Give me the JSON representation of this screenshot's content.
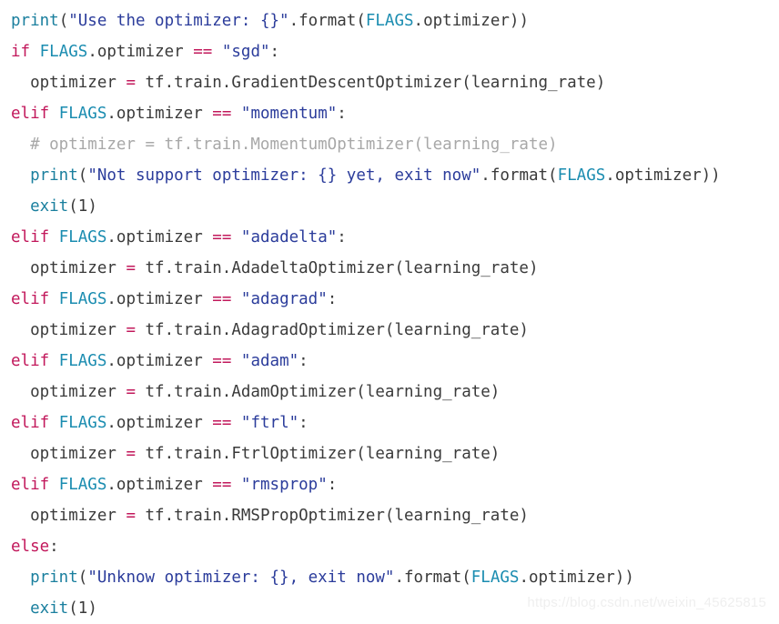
{
  "page": {
    "background": "#ffffff",
    "language": "python",
    "line_count": 20
  },
  "theme": {
    "keyword": "#c2185b",
    "operator": "#c2185b",
    "builtin": "#1a7f9e",
    "name": "#1a8cb0",
    "string": "#2b3c9b",
    "plain": "#3a3a3a",
    "comment": "#a8a8a8",
    "watermark": "#efefef"
  },
  "watermark": {
    "text": "https://blog.csdn.net/weixin_45625815"
  },
  "code": {
    "lines": [
      {
        "index": 1,
        "text": "print(\"Use the optimizer: {}\".format(FLAGS.optimizer))",
        "tokens": [
          {
            "t": "print",
            "c": "builtin"
          },
          {
            "t": "(",
            "c": "punct"
          },
          {
            "t": "\"Use the optimizer: {}\"",
            "c": "str"
          },
          {
            "t": ".format(",
            "c": "plain"
          },
          {
            "t": "FLAGS",
            "c": "name"
          },
          {
            "t": ".optimizer))",
            "c": "plain"
          }
        ]
      },
      {
        "index": 2,
        "text": "if FLAGS.optimizer == \"sgd\":",
        "tokens": [
          {
            "t": "if",
            "c": "kw"
          },
          {
            "t": " ",
            "c": "plain"
          },
          {
            "t": "FLAGS",
            "c": "name"
          },
          {
            "t": ".optimizer ",
            "c": "plain"
          },
          {
            "t": "==",
            "c": "op"
          },
          {
            "t": " ",
            "c": "plain"
          },
          {
            "t": "\"sgd\"",
            "c": "str"
          },
          {
            "t": ":",
            "c": "punct"
          }
        ]
      },
      {
        "index": 3,
        "text": "  optimizer = tf.train.GradientDescentOptimizer(learning_rate)",
        "tokens": [
          {
            "t": "  optimizer ",
            "c": "plain"
          },
          {
            "t": "=",
            "c": "op"
          },
          {
            "t": " tf.train.GradientDescentOptimizer(learning_rate)",
            "c": "plain"
          }
        ]
      },
      {
        "index": 4,
        "text": "elif FLAGS.optimizer == \"momentum\":",
        "tokens": [
          {
            "t": "elif",
            "c": "kw"
          },
          {
            "t": " ",
            "c": "plain"
          },
          {
            "t": "FLAGS",
            "c": "name"
          },
          {
            "t": ".optimizer ",
            "c": "plain"
          },
          {
            "t": "==",
            "c": "op"
          },
          {
            "t": " ",
            "c": "plain"
          },
          {
            "t": "\"momentum\"",
            "c": "str"
          },
          {
            "t": ":",
            "c": "punct"
          }
        ]
      },
      {
        "index": 5,
        "text": "  # optimizer = tf.train.MomentumOptimizer(learning_rate)",
        "tokens": [
          {
            "t": "  # optimizer = tf.train.MomentumOptimizer(learning_rate)",
            "c": "comment"
          }
        ]
      },
      {
        "index": 6,
        "text": "  print(\"Not support optimizer: {} yet, exit now\".format(FLAGS.optimizer))",
        "tokens": [
          {
            "t": "  ",
            "c": "plain"
          },
          {
            "t": "print",
            "c": "builtin"
          },
          {
            "t": "(",
            "c": "punct"
          },
          {
            "t": "\"Not support optimizer: {} yet, exit now\"",
            "c": "str"
          },
          {
            "t": ".format(",
            "c": "plain"
          },
          {
            "t": "FLAGS",
            "c": "name"
          },
          {
            "t": ".optimizer))",
            "c": "plain"
          }
        ]
      },
      {
        "index": 7,
        "text": "  exit(1)",
        "tokens": [
          {
            "t": "  ",
            "c": "plain"
          },
          {
            "t": "exit",
            "c": "builtin"
          },
          {
            "t": "(",
            "c": "punct"
          },
          {
            "t": "1",
            "c": "num"
          },
          {
            "t": ")",
            "c": "punct"
          }
        ]
      },
      {
        "index": 8,
        "text": "elif FLAGS.optimizer == \"adadelta\":",
        "tokens": [
          {
            "t": "elif",
            "c": "kw"
          },
          {
            "t": " ",
            "c": "plain"
          },
          {
            "t": "FLAGS",
            "c": "name"
          },
          {
            "t": ".optimizer ",
            "c": "plain"
          },
          {
            "t": "==",
            "c": "op"
          },
          {
            "t": " ",
            "c": "plain"
          },
          {
            "t": "\"adadelta\"",
            "c": "str"
          },
          {
            "t": ":",
            "c": "punct"
          }
        ]
      },
      {
        "index": 9,
        "text": "  optimizer = tf.train.AdadeltaOptimizer(learning_rate)",
        "tokens": [
          {
            "t": "  optimizer ",
            "c": "plain"
          },
          {
            "t": "=",
            "c": "op"
          },
          {
            "t": " tf.train.AdadeltaOptimizer(learning_rate)",
            "c": "plain"
          }
        ]
      },
      {
        "index": 10,
        "text": "elif FLAGS.optimizer == \"adagrad\":",
        "tokens": [
          {
            "t": "elif",
            "c": "kw"
          },
          {
            "t": " ",
            "c": "plain"
          },
          {
            "t": "FLAGS",
            "c": "name"
          },
          {
            "t": ".optimizer ",
            "c": "plain"
          },
          {
            "t": "==",
            "c": "op"
          },
          {
            "t": " ",
            "c": "plain"
          },
          {
            "t": "\"adagrad\"",
            "c": "str"
          },
          {
            "t": ":",
            "c": "punct"
          }
        ]
      },
      {
        "index": 11,
        "text": "  optimizer = tf.train.AdagradOptimizer(learning_rate)",
        "tokens": [
          {
            "t": "  optimizer ",
            "c": "plain"
          },
          {
            "t": "=",
            "c": "op"
          },
          {
            "t": " tf.train.AdagradOptimizer(learning_rate)",
            "c": "plain"
          }
        ]
      },
      {
        "index": 12,
        "text": "elif FLAGS.optimizer == \"adam\":",
        "tokens": [
          {
            "t": "elif",
            "c": "kw"
          },
          {
            "t": " ",
            "c": "plain"
          },
          {
            "t": "FLAGS",
            "c": "name"
          },
          {
            "t": ".optimizer ",
            "c": "plain"
          },
          {
            "t": "==",
            "c": "op"
          },
          {
            "t": " ",
            "c": "plain"
          },
          {
            "t": "\"adam\"",
            "c": "str"
          },
          {
            "t": ":",
            "c": "punct"
          }
        ]
      },
      {
        "index": 13,
        "text": "  optimizer = tf.train.AdamOptimizer(learning_rate)",
        "tokens": [
          {
            "t": "  optimizer ",
            "c": "plain"
          },
          {
            "t": "=",
            "c": "op"
          },
          {
            "t": " tf.train.AdamOptimizer(learning_rate)",
            "c": "plain"
          }
        ]
      },
      {
        "index": 14,
        "text": "elif FLAGS.optimizer == \"ftrl\":",
        "tokens": [
          {
            "t": "elif",
            "c": "kw"
          },
          {
            "t": " ",
            "c": "plain"
          },
          {
            "t": "FLAGS",
            "c": "name"
          },
          {
            "t": ".optimizer ",
            "c": "plain"
          },
          {
            "t": "==",
            "c": "op"
          },
          {
            "t": " ",
            "c": "plain"
          },
          {
            "t": "\"ftrl\"",
            "c": "str"
          },
          {
            "t": ":",
            "c": "punct"
          }
        ]
      },
      {
        "index": 15,
        "text": "  optimizer = tf.train.FtrlOptimizer(learning_rate)",
        "tokens": [
          {
            "t": "  optimizer ",
            "c": "plain"
          },
          {
            "t": "=",
            "c": "op"
          },
          {
            "t": " tf.train.FtrlOptimizer(learning_rate)",
            "c": "plain"
          }
        ]
      },
      {
        "index": 16,
        "text": "elif FLAGS.optimizer == \"rmsprop\":",
        "tokens": [
          {
            "t": "elif",
            "c": "kw"
          },
          {
            "t": " ",
            "c": "plain"
          },
          {
            "t": "FLAGS",
            "c": "name"
          },
          {
            "t": ".optimizer ",
            "c": "plain"
          },
          {
            "t": "==",
            "c": "op"
          },
          {
            "t": " ",
            "c": "plain"
          },
          {
            "t": "\"rmsprop\"",
            "c": "str"
          },
          {
            "t": ":",
            "c": "punct"
          }
        ]
      },
      {
        "index": 17,
        "text": "  optimizer = tf.train.RMSPropOptimizer(learning_rate)",
        "tokens": [
          {
            "t": "  optimizer ",
            "c": "plain"
          },
          {
            "t": "=",
            "c": "op"
          },
          {
            "t": " tf.train.RMSPropOptimizer(learning_rate)",
            "c": "plain"
          }
        ]
      },
      {
        "index": 18,
        "text": "else:",
        "tokens": [
          {
            "t": "else",
            "c": "kw"
          },
          {
            "t": ":",
            "c": "punct"
          }
        ]
      },
      {
        "index": 19,
        "text": "  print(\"Unknow optimizer: {}, exit now\".format(FLAGS.optimizer))",
        "tokens": [
          {
            "t": "  ",
            "c": "plain"
          },
          {
            "t": "print",
            "c": "builtin"
          },
          {
            "t": "(",
            "c": "punct"
          },
          {
            "t": "\"Unknow optimizer: {}, exit now\"",
            "c": "str"
          },
          {
            "t": ".format(",
            "c": "plain"
          },
          {
            "t": "FLAGS",
            "c": "name"
          },
          {
            "t": ".optimizer))",
            "c": "plain"
          }
        ]
      },
      {
        "index": 20,
        "text": "  exit(1)",
        "tokens": [
          {
            "t": "  ",
            "c": "plain"
          },
          {
            "t": "exit",
            "c": "builtin"
          },
          {
            "t": "(",
            "c": "punct"
          },
          {
            "t": "1",
            "c": "num"
          },
          {
            "t": ")",
            "c": "punct"
          }
        ]
      }
    ]
  }
}
